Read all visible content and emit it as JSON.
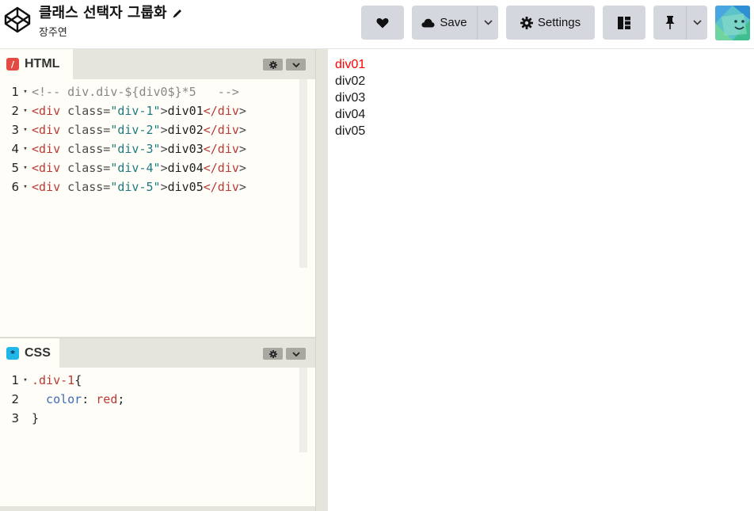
{
  "header": {
    "title": "클래스 선택자 그룹화",
    "author": "장주연",
    "buttons": {
      "save_label": "Save",
      "settings_label": "Settings"
    }
  },
  "panels": {
    "html": {
      "label": "HTML",
      "lines": [
        {
          "num": "1",
          "parts": [
            {
              "t": "<!-- div.div-${div0$}*5   -->",
              "c": "comment"
            }
          ]
        },
        {
          "num": "2",
          "parts": [
            {
              "t": "<div",
              "c": "tag"
            },
            {
              "t": " class=",
              "c": "attr"
            },
            {
              "t": "\"div-1\"",
              "c": "str"
            },
            {
              "t": ">",
              "c": "attr"
            },
            {
              "t": "div01",
              "c": "text"
            },
            {
              "t": "</div",
              "c": "tag"
            },
            {
              "t": ">",
              "c": "attr"
            }
          ]
        },
        {
          "num": "3",
          "parts": [
            {
              "t": "<div",
              "c": "tag"
            },
            {
              "t": " class=",
              "c": "attr"
            },
            {
              "t": "\"div-2\"",
              "c": "str"
            },
            {
              "t": ">",
              "c": "attr"
            },
            {
              "t": "div02",
              "c": "text"
            },
            {
              "t": "</div",
              "c": "tag"
            },
            {
              "t": ">",
              "c": "attr"
            }
          ]
        },
        {
          "num": "4",
          "parts": [
            {
              "t": "<div",
              "c": "tag"
            },
            {
              "t": " class=",
              "c": "attr"
            },
            {
              "t": "\"div-3\"",
              "c": "str"
            },
            {
              "t": ">",
              "c": "attr"
            },
            {
              "t": "div03",
              "c": "text"
            },
            {
              "t": "</div",
              "c": "tag"
            },
            {
              "t": ">",
              "c": "attr"
            }
          ]
        },
        {
          "num": "5",
          "parts": [
            {
              "t": "<div",
              "c": "tag"
            },
            {
              "t": " class=",
              "c": "attr"
            },
            {
              "t": "\"div-4\"",
              "c": "str"
            },
            {
              "t": ">",
              "c": "attr"
            },
            {
              "t": "div04",
              "c": "text"
            },
            {
              "t": "</div",
              "c": "tag"
            },
            {
              "t": ">",
              "c": "attr"
            }
          ]
        },
        {
          "num": "6",
          "parts": [
            {
              "t": "<div",
              "c": "tag"
            },
            {
              "t": " class=",
              "c": "attr"
            },
            {
              "t": "\"div-5\"",
              "c": "str"
            },
            {
              "t": ">",
              "c": "attr"
            },
            {
              "t": "div05",
              "c": "text"
            },
            {
              "t": "</div",
              "c": "tag"
            },
            {
              "t": ">",
              "c": "attr"
            }
          ]
        }
      ]
    },
    "css": {
      "label": "CSS",
      "lines": [
        {
          "num": "1",
          "parts": [
            {
              "t": ".div-1",
              "c": "sel"
            },
            {
              "t": "{",
              "c": "text"
            }
          ]
        },
        {
          "num": "2",
          "parts": [
            {
              "t": "  color",
              "c": "prop"
            },
            {
              "t": ": ",
              "c": "text"
            },
            {
              "t": "red",
              "c": "val"
            },
            {
              "t": ";",
              "c": "text"
            }
          ]
        },
        {
          "num": "3",
          "parts": [
            {
              "t": "}",
              "c": "text"
            }
          ]
        }
      ]
    }
  },
  "preview": {
    "items": [
      "div01",
      "div02",
      "div03",
      "div04",
      "div05"
    ],
    "first_item_color": "#ff0000"
  },
  "colors": {
    "html_badge": "#e34b43",
    "css_badge": "#1fb6e8",
    "button_bg": "#d5d7de"
  }
}
